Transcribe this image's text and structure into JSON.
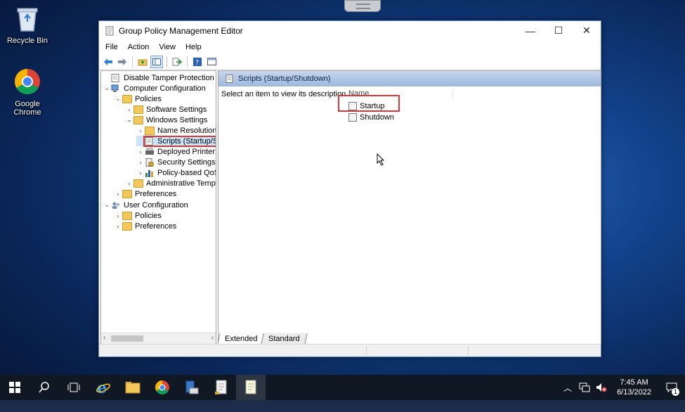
{
  "desktop": {
    "icons": [
      {
        "label": "Recycle Bin"
      },
      {
        "label": "Google Chrome"
      }
    ]
  },
  "window": {
    "title": "Group Policy Management Editor",
    "controls": {
      "minimize": "—",
      "maximize": "☐",
      "close": "✕"
    }
  },
  "menubar": {
    "items": [
      "File",
      "Action",
      "View",
      "Help"
    ]
  },
  "tree": {
    "items": [
      {
        "label": "Disable Tamper Protection Soph",
        "expander": ""
      },
      {
        "label": "Computer Configuration",
        "expander": "⌄"
      },
      {
        "label": "Policies",
        "expander": "⌄"
      },
      {
        "label": "Software Settings",
        "expander": "›"
      },
      {
        "label": "Windows Settings",
        "expander": "⌄"
      },
      {
        "label": "Name Resolution",
        "expander": "›"
      },
      {
        "label": "Scripts (Startup/S",
        "expander": ""
      },
      {
        "label": "Deployed Printer:",
        "expander": "›"
      },
      {
        "label": "Security Settings",
        "expander": "›"
      },
      {
        "label": "Policy-based QoS",
        "expander": "›"
      },
      {
        "label": "Administrative Temp",
        "expander": "›"
      },
      {
        "label": "Preferences",
        "expander": "›"
      },
      {
        "label": "User Configuration",
        "expander": "⌄"
      },
      {
        "label": "Policies",
        "expander": "›"
      },
      {
        "label": "Preferences",
        "expander": "›"
      }
    ],
    "selected_index": 6
  },
  "right_pane": {
    "header": "Scripts (Startup/Shutdown)",
    "description": "Select an item to view its description.",
    "column_name": "Name",
    "items": [
      "Startup",
      "Shutdown"
    ]
  },
  "tabs": [
    "Extended",
    "Standard"
  ],
  "taskbar": {
    "clock_time": "7:45 AM",
    "clock_date": "6/13/2022",
    "notification_count": "1"
  },
  "colors": {
    "highlight_box": "#d6393c",
    "taskbar": "#101823",
    "pane_header": "#9db9de"
  }
}
